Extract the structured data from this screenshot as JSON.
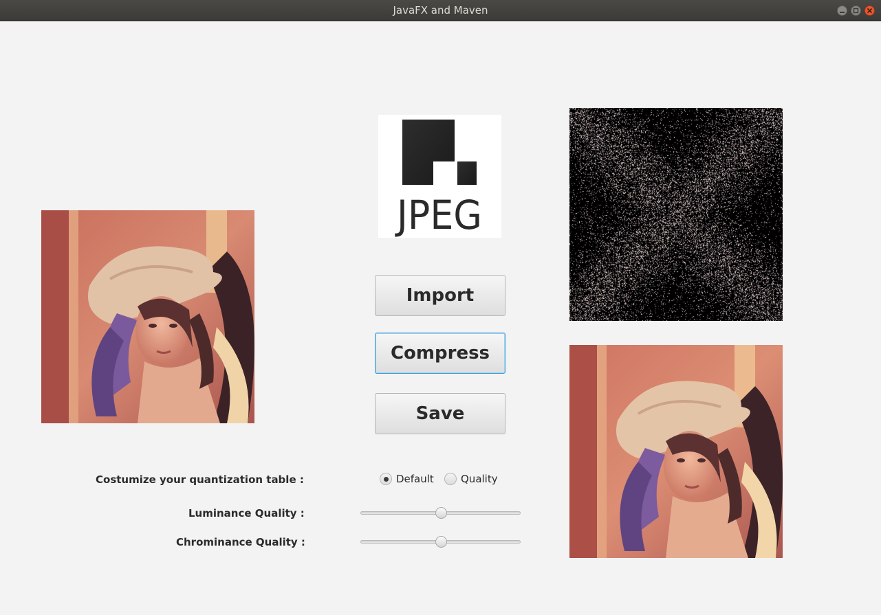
{
  "window": {
    "title": "JavaFX and Maven"
  },
  "logo": {
    "text": "JPEG"
  },
  "buttons": {
    "import": "Import",
    "compress": "Compress",
    "save": "Save"
  },
  "quantization": {
    "label": "Costumize your quantization table :",
    "options": [
      {
        "label": "Default",
        "selected": true
      },
      {
        "label": "Quality",
        "selected": false
      }
    ]
  },
  "luminance": {
    "label": "Luminance Quality :",
    "value": 0.5
  },
  "chrominance": {
    "label": "Chrominance Quality :",
    "value": 0.5
  },
  "colors": {
    "titlebar": "#3b3a37",
    "close_button": "#e9582f",
    "focus_border": "#3f9fd6",
    "background": "#f3f3f3"
  }
}
